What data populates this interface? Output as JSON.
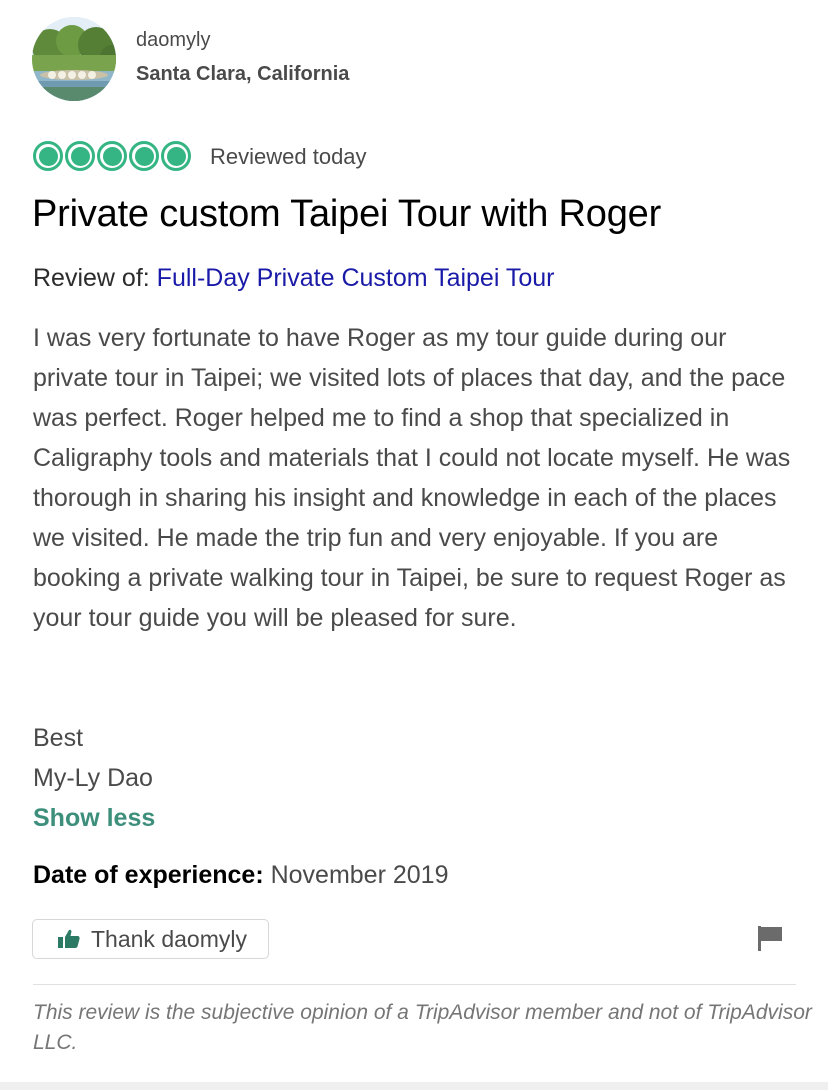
{
  "reviewer": {
    "username": "daomyly",
    "location": "Santa Clara, California"
  },
  "rating": {
    "bubbles": 5,
    "max": 5,
    "color": "#34b583",
    "reviewed_label": "Reviewed today"
  },
  "review": {
    "title": "Private custom Taipei Tour with Roger",
    "review_of_label": "Review of:",
    "review_of_link": "Full-Day Private Custom Taipei Tour",
    "body": "I was very fortunate to have Roger as my tour guide during our private tour in Taipei; we visited lots of places that day, and the pace was perfect. Roger helped me to find a shop that specialized in Caligraphy tools and materials that I could not locate myself. He was thorough in sharing his insight and knowledge in each of the places we visited. He made the trip fun and very enjoyable. If you are booking a private walking tour in Taipei, be sure to request Roger as your tour guide you will be pleased for sure.",
    "signoff_line1": "Best",
    "signoff_line2": "My-Ly Dao",
    "show_less_label": "Show less",
    "date_label": "Date of experience:",
    "date_value": "November 2019"
  },
  "actions": {
    "thank_label": "Thank daomyly",
    "thumb_icon": "thumbs-up-icon",
    "flag_icon": "flag-icon"
  },
  "disclaimer": "This review is the subjective opinion of a TripAdvisor member and not of TripAdvisor LLC."
}
